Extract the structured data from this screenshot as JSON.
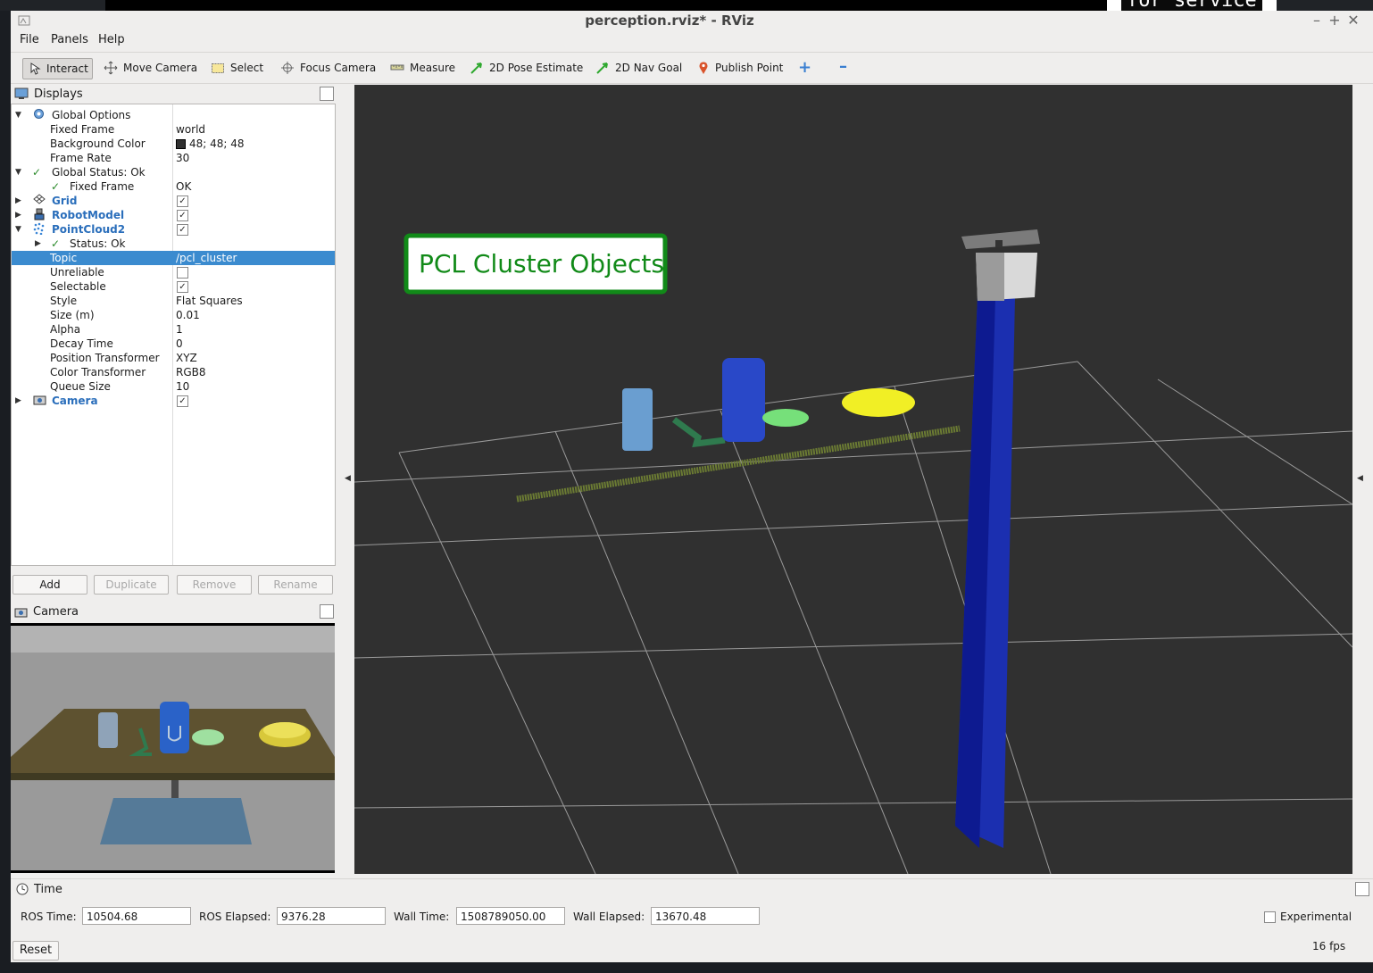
{
  "desktop": {
    "background_text": "for service"
  },
  "window": {
    "title": "perception.rviz* - RViz",
    "min_glyph": "–",
    "max_glyph": "+",
    "close_glyph": "✕"
  },
  "menu": {
    "items": [
      "File",
      "Panels",
      "Help"
    ]
  },
  "toolbar": {
    "tools": [
      {
        "label": "Interact",
        "icon": "cursor-icon"
      },
      {
        "label": "Move Camera",
        "icon": "move-icon"
      },
      {
        "label": "Select",
        "icon": "select-box-icon"
      },
      {
        "label": "Focus Camera",
        "icon": "crosshair-icon"
      },
      {
        "label": "Measure",
        "icon": "ruler-icon"
      },
      {
        "label": "2D Pose Estimate",
        "icon": "green-arrow-icon"
      },
      {
        "label": "2D Nav Goal",
        "icon": "green-arrow-icon"
      },
      {
        "label": "Publish Point",
        "icon": "map-pin-icon"
      }
    ],
    "add_tool_glyph": "+",
    "remove_tool_glyph": "–"
  },
  "displays": {
    "title": "Displays",
    "tree": {
      "global_options": "Global Options",
      "fixed_frame": {
        "name": "Fixed Frame",
        "value": "world"
      },
      "background_color": {
        "name": "Background Color",
        "value": "48; 48; 48",
        "swatch": "#303030"
      },
      "frame_rate": {
        "name": "Frame Rate",
        "value": "30"
      },
      "global_status": "Global Status: Ok",
      "status_fixed_frame": {
        "name": "Fixed Frame",
        "value": "OK"
      },
      "grid": "Grid",
      "robot_model": "RobotModel",
      "pointcloud2": "PointCloud2",
      "pc_status": "Status: Ok",
      "topic": {
        "name": "Topic",
        "value": "/pcl_cluster"
      },
      "unreliable": {
        "name": "Unreliable",
        "checked": false
      },
      "selectable": {
        "name": "Selectable",
        "checked": true
      },
      "style": {
        "name": "Style",
        "value": "Flat Squares"
      },
      "size": {
        "name": "Size (m)",
        "value": "0.01"
      },
      "alpha": {
        "name": "Alpha",
        "value": "1"
      },
      "decay": {
        "name": "Decay Time",
        "value": "0"
      },
      "position_transformer": {
        "name": "Position Transformer",
        "value": "XYZ"
      },
      "color_transformer": {
        "name": "Color Transformer",
        "value": "RGB8"
      },
      "queue_size": {
        "name": "Queue Size",
        "value": "10"
      },
      "camera": "Camera",
      "check_mark": "✓"
    },
    "buttons": {
      "add": "Add",
      "duplicate": "Duplicate",
      "remove": "Remove",
      "rename": "Rename"
    }
  },
  "camera_panel": {
    "title": "Camera"
  },
  "viewport": {
    "overlay_text": "PCL Cluster Objects"
  },
  "time_panel": {
    "title": "Time",
    "ros_time_label": "ROS Time:",
    "ros_time": "10504.68",
    "ros_elapsed_label": "ROS Elapsed:",
    "ros_elapsed": "9376.28",
    "wall_time_label": "Wall Time:",
    "wall_time": "1508789050.00",
    "wall_elapsed_label": "Wall Elapsed:",
    "wall_elapsed": "13670.48",
    "experimental": "Experimental",
    "reset": "Reset",
    "fps": "16 fps"
  }
}
